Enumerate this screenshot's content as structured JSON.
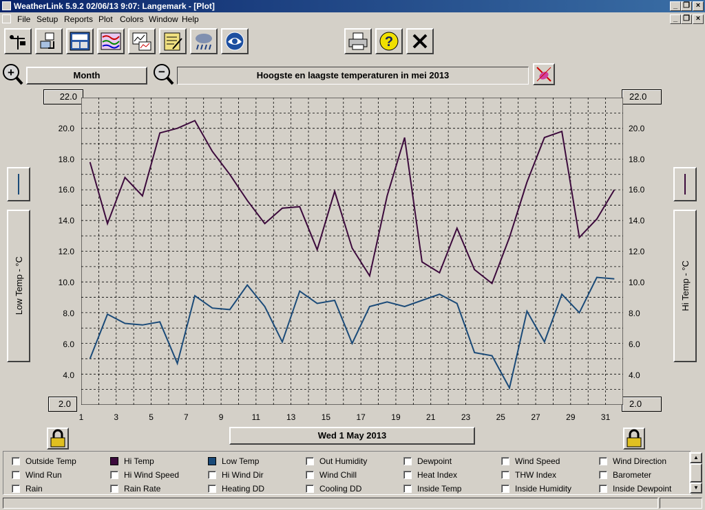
{
  "window": {
    "title": "WeatherLink 5.9.2  02/06/13   9:07: Langemark - [Plot]"
  },
  "menu": [
    "File",
    "Setup",
    "Reports",
    "Plot",
    "Colors",
    "Window",
    "Help"
  ],
  "toolbar": {
    "icons": [
      "station-icon",
      "download-icon",
      "bulletin-icon",
      "strip-chart-icon",
      "graph-icon",
      "notes-icon",
      "weather-icon",
      "noaa-icon",
      "print-icon",
      "help-icon",
      "close-icon"
    ]
  },
  "controls": {
    "zoom_in": "+",
    "zoom_out": "−",
    "period": "Month",
    "plot_title": "Hoogste en laagste temperaturen in mei 2013"
  },
  "left_axis": {
    "label": "Low Temp - °C",
    "top": "22.0",
    "bottom": "2.0",
    "ticks": [
      "20.0",
      "18.0",
      "16.0",
      "14.0",
      "12.0",
      "10.0",
      "8.0",
      "6.0",
      "4.0"
    ]
  },
  "right_axis": {
    "label": "Hi Temp - °C",
    "top": "22.0",
    "bottom": "2.0",
    "ticks": [
      "20.0",
      "18.0",
      "16.0",
      "14.0",
      "12.0",
      "10.0",
      "8.0",
      "6.0",
      "4.0"
    ]
  },
  "x_axis": {
    "ticks": [
      "1",
      "3",
      "5",
      "7",
      "9",
      "11",
      "13",
      "15",
      "17",
      "19",
      "21",
      "23",
      "25",
      "27",
      "29",
      "31"
    ],
    "date_label": "Wed 1 May 2013"
  },
  "colors": {
    "hi": "#3c0a3c",
    "lo": "#1a4a78",
    "grid": "#000000",
    "plot_bg": "#d4d0c8"
  },
  "chart_data": {
    "type": "line",
    "title": "Hoogste en laagste temperaturen in mei 2013",
    "xlabel": "",
    "xlim": [
      1,
      32
    ],
    "ylim": [
      2,
      22
    ],
    "grid": true,
    "x": [
      1.5,
      2.5,
      3.5,
      4.5,
      5.5,
      6.5,
      7.5,
      8.5,
      9.5,
      10.5,
      11.5,
      12.5,
      13.5,
      14.5,
      15.5,
      16.5,
      17.5,
      18.5,
      19.5,
      20.5,
      21.5,
      22.5,
      23.5,
      24.5,
      25.5,
      26.5,
      27.5,
      28.5,
      29.5,
      30.5,
      31.5
    ],
    "series": [
      {
        "name": "Hi Temp",
        "axis": "right",
        "color": "#3c0a3c",
        "values": [
          17.8,
          13.8,
          16.8,
          15.6,
          19.7,
          20.0,
          20.5,
          18.5,
          17.0,
          15.3,
          13.8,
          14.8,
          14.9,
          12.1,
          15.9,
          12.2,
          10.4,
          15.6,
          19.4,
          11.3,
          10.6,
          13.5,
          10.8,
          9.9,
          12.9,
          16.5,
          19.4,
          19.8,
          12.9,
          14.1,
          16.0
        ]
      },
      {
        "name": "Low Temp",
        "axis": "left",
        "color": "#1a4a78",
        "values": [
          5.0,
          7.9,
          7.3,
          7.2,
          7.4,
          4.7,
          9.1,
          8.3,
          8.2,
          9.8,
          8.4,
          6.1,
          9.4,
          8.6,
          8.8,
          6.0,
          8.4,
          8.7,
          8.4,
          8.8,
          9.2,
          8.6,
          5.4,
          5.2,
          3.1,
          8.1,
          6.1,
          9.2,
          8.0,
          10.3,
          10.2
        ]
      }
    ]
  },
  "legend": [
    {
      "label": "Outside Temp",
      "checked": false
    },
    {
      "label": "Hi Temp",
      "checked": true,
      "color": "#3c0a3c"
    },
    {
      "label": "Low Temp",
      "checked": true,
      "color": "#1a4a78"
    },
    {
      "label": "Out Humidity",
      "checked": false
    },
    {
      "label": "Dewpoint",
      "checked": false
    },
    {
      "label": "Wind Speed",
      "checked": false
    },
    {
      "label": "Wind Direction",
      "checked": false
    },
    {
      "label": "Wind Run",
      "checked": false
    },
    {
      "label": "Hi Wind Speed",
      "checked": false
    },
    {
      "label": "Hi Wind Dir",
      "checked": false
    },
    {
      "label": "Wind Chill",
      "checked": false
    },
    {
      "label": "Heat Index",
      "checked": false
    },
    {
      "label": "THW Index",
      "checked": false
    },
    {
      "label": "Barometer",
      "checked": false
    },
    {
      "label": "Rain",
      "checked": false
    },
    {
      "label": "Rain Rate",
      "checked": false
    },
    {
      "label": "Heating DD",
      "checked": false
    },
    {
      "label": "Cooling DD",
      "checked": false
    },
    {
      "label": "Inside Temp",
      "checked": false
    },
    {
      "label": "Inside Humidity",
      "checked": false
    },
    {
      "label": "Inside Dewpoint",
      "checked": false
    }
  ]
}
